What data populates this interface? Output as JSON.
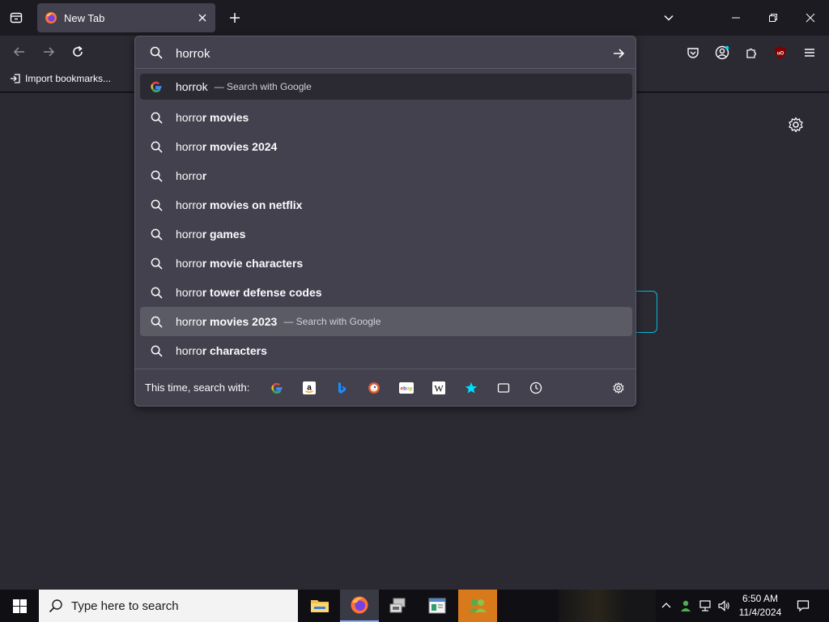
{
  "tabs": [
    {
      "title": "New Tab",
      "icon": "firefox-icon"
    }
  ],
  "urlbar": {
    "value": "horrok",
    "placeholder": "",
    "results": [
      {
        "typed": "horrok",
        "suggestion": "",
        "action": "— Search with Google",
        "icon": "google-icon",
        "state": "selected"
      },
      {
        "typed": "horro",
        "suggestion": "r movies",
        "action": "",
        "icon": "search-icon",
        "state": ""
      },
      {
        "typed": "horro",
        "suggestion": "r movies 2024",
        "action": "",
        "icon": "search-icon",
        "state": ""
      },
      {
        "typed": "horro",
        "suggestion": "r",
        "action": "",
        "icon": "search-icon",
        "state": ""
      },
      {
        "typed": "horro",
        "suggestion": "r movies on netflix",
        "action": "",
        "icon": "search-icon",
        "state": ""
      },
      {
        "typed": "horro",
        "suggestion": "r games",
        "action": "",
        "icon": "search-icon",
        "state": ""
      },
      {
        "typed": "horro",
        "suggestion": "r movie characters",
        "action": "",
        "icon": "search-icon",
        "state": ""
      },
      {
        "typed": "horro",
        "suggestion": "r tower defense codes",
        "action": "",
        "icon": "search-icon",
        "state": ""
      },
      {
        "typed": "horro",
        "suggestion": "r movies 2023",
        "action": "— Search with Google",
        "icon": "search-icon",
        "state": "hover"
      },
      {
        "typed": "horro",
        "suggestion": "r characters",
        "action": "",
        "icon": "search-icon",
        "state": ""
      }
    ],
    "oneoff_label": "This time, search with:",
    "engines": [
      "google-icon",
      "amazon-icon",
      "bing-icon",
      "duckduckgo-icon",
      "ebay-icon",
      "wikipedia-icon",
      "bookmarks-icon",
      "tabs-icon",
      "history-icon"
    ]
  },
  "bookmarks": {
    "import_label": "Import bookmarks..."
  },
  "taskbar": {
    "search_placeholder": "Type here to search",
    "time": "6:50 AM",
    "date": "11/4/2024",
    "apps": [
      "file-explorer-icon",
      "firefox-icon",
      "network-app-icon",
      "notepad-app-icon",
      "people-app-icon"
    ]
  },
  "colors": {
    "accent": "#00ddff",
    "panel": "#42414d",
    "toolbar": "#2b2a33"
  }
}
